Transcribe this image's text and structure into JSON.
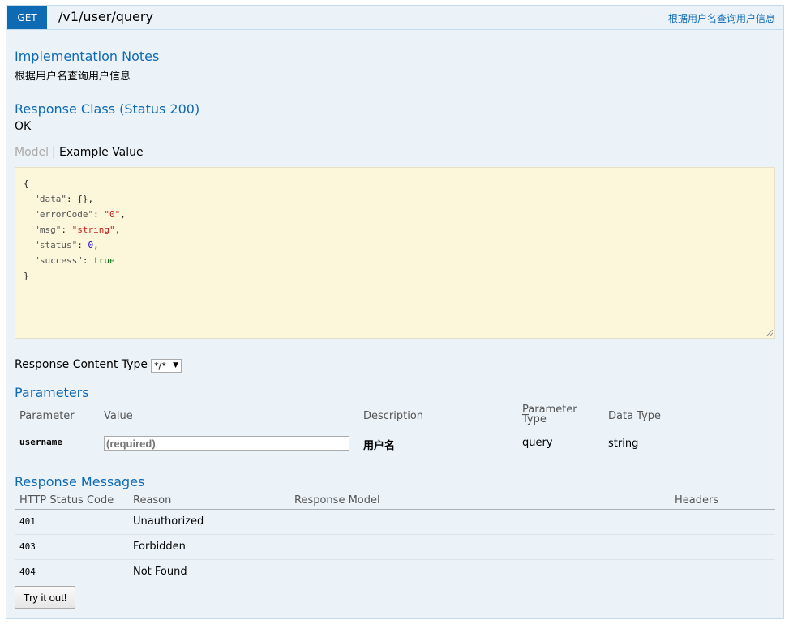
{
  "operation": {
    "method": "GET",
    "path": "/v1/user/query",
    "summary": "根据用户名查询用户信息"
  },
  "implementation_notes": {
    "heading": "Implementation Notes",
    "text": "根据用户名查询用户信息"
  },
  "response_class": {
    "heading": "Response Class (Status 200)",
    "text": "OK",
    "tabs": {
      "model": "Model",
      "example": "Example Value"
    },
    "example": {
      "open": "{",
      "close": "}",
      "lines": [
        {
          "key": "\"data\"",
          "value": "{}",
          "type": "plain",
          "comma": ","
        },
        {
          "key": "\"errorCode\"",
          "value": "\"0\"",
          "type": "str",
          "comma": ","
        },
        {
          "key": "\"msg\"",
          "value": "\"string\"",
          "type": "str",
          "comma": ","
        },
        {
          "key": "\"status\"",
          "value": "0",
          "type": "num",
          "comma": ","
        },
        {
          "key": "\"success\"",
          "value": "true",
          "type": "bool",
          "comma": ""
        }
      ]
    }
  },
  "response_content_type": {
    "label": "Response Content Type",
    "selected": "*/*"
  },
  "parameters": {
    "heading": "Parameters",
    "headers": {
      "parameter": "Parameter",
      "value": "Value",
      "description": "Description",
      "param_type_1": "Parameter",
      "param_type_2": "Type",
      "data_type": "Data Type"
    },
    "rows": [
      {
        "name": "username",
        "placeholder": "(required)",
        "description": "用户名",
        "param_type": "query",
        "data_type": "string"
      }
    ]
  },
  "response_messages": {
    "heading": "Response Messages",
    "headers": {
      "code": "HTTP Status Code",
      "reason": "Reason",
      "model": "Response Model",
      "headers": "Headers"
    },
    "rows": [
      {
        "code": "401",
        "reason": "Unauthorized"
      },
      {
        "code": "403",
        "reason": "Forbidden"
      },
      {
        "code": "404",
        "reason": "Not Found"
      }
    ]
  },
  "try_button": "Try it out!",
  "colors": {
    "get_method": "#0f6ab4",
    "panel_bg": "#ebf3f9",
    "heading": "#0f6ab4",
    "sample_bg": "#fcf6db"
  }
}
